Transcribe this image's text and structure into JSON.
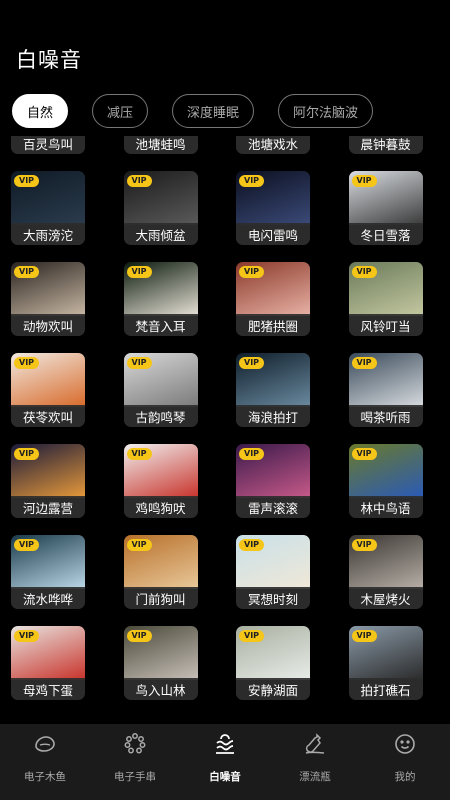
{
  "header": {
    "title": "白噪音"
  },
  "tabs": [
    "自然",
    "减压",
    "深度睡眠",
    "阿尔法脑波"
  ],
  "vip_badge": "VIP",
  "sounds": [
    {
      "label": "百灵鸟叫",
      "vip": false,
      "colors": [
        "#3a3520",
        "#6b5a2e"
      ]
    },
    {
      "label": "池塘蛙鸣",
      "vip": false,
      "colors": [
        "#1f4a22",
        "#3c7a36"
      ]
    },
    {
      "label": "池塘戏水",
      "vip": false,
      "colors": [
        "#1c5a4a",
        "#2f8a6e"
      ]
    },
    {
      "label": "晨钟暮鼓",
      "vip": false,
      "colors": [
        "#2a2a2a",
        "#4a4a4a"
      ]
    },
    {
      "label": "大雨滂沱",
      "vip": true,
      "colors": [
        "#0f1a25",
        "#2b3c4e"
      ]
    },
    {
      "label": "大雨倾盆",
      "vip": true,
      "colors": [
        "#1b1b1b",
        "#5a5a5a"
      ]
    },
    {
      "label": "电闪雷鸣",
      "vip": true,
      "colors": [
        "#0b0f1f",
        "#3b4a78"
      ]
    },
    {
      "label": "冬日雪落",
      "vip": true,
      "colors": [
        "#d9dde2",
        "#3a3a3a"
      ]
    },
    {
      "label": "动物欢叫",
      "vip": true,
      "colors": [
        "#2a2420",
        "#c8b8a4"
      ]
    },
    {
      "label": "梵音入耳",
      "vip": true,
      "colors": [
        "#0a1a0c",
        "#e8e2d8"
      ]
    },
    {
      "label": "肥猪拱圈",
      "vip": true,
      "colors": [
        "#8a3a2a",
        "#e8b2a6"
      ]
    },
    {
      "label": "风铃叮当",
      "vip": true,
      "colors": [
        "#6a7a5a",
        "#c4c8a0"
      ]
    },
    {
      "label": "茯苓欢叫",
      "vip": true,
      "colors": [
        "#f0e8e0",
        "#d86a2a"
      ]
    },
    {
      "label": "古韵鸣琴",
      "vip": true,
      "colors": [
        "#d8d8d8",
        "#7a7a7a"
      ]
    },
    {
      "label": "海浪拍打",
      "vip": true,
      "colors": [
        "#0f1e2a",
        "#6a8aa0"
      ]
    },
    {
      "label": "喝茶听雨",
      "vip": true,
      "colors": [
        "#3a4a5a",
        "#d8dce0"
      ]
    },
    {
      "label": "河边露营",
      "vip": true,
      "colors": [
        "#1a1a3a",
        "#e89a3a"
      ]
    },
    {
      "label": "鸡鸣狗吠",
      "vip": true,
      "colors": [
        "#f0f0f0",
        "#c8322a"
      ]
    },
    {
      "label": "雷声滚滚",
      "vip": true,
      "colors": [
        "#3a1a4a",
        "#c85a8a"
      ]
    },
    {
      "label": "林中鸟语",
      "vip": true,
      "colors": [
        "#6a7a2a",
        "#2a5ab8"
      ]
    },
    {
      "label": "流水哗哗",
      "vip": true,
      "colors": [
        "#1a3a4a",
        "#bcd8e8"
      ]
    },
    {
      "label": "门前狗叫",
      "vip": true,
      "colors": [
        "#b8702a",
        "#e8c89a"
      ]
    },
    {
      "label": "冥想时刻",
      "vip": true,
      "colors": [
        "#c8e0e8",
        "#f0e8d8"
      ]
    },
    {
      "label": "木屋烤火",
      "vip": true,
      "colors": [
        "#3a3632",
        "#b8b0a8"
      ]
    },
    {
      "label": "母鸡下蛋",
      "vip": true,
      "colors": [
        "#e8e4e0",
        "#c8322a"
      ]
    },
    {
      "label": "鸟入山林",
      "vip": true,
      "colors": [
        "#4a4a3a",
        "#c8c0b8"
      ]
    },
    {
      "label": "安静湖面",
      "vip": true,
      "colors": [
        "#a8b0a0",
        "#e8ece8"
      ]
    },
    {
      "label": "拍打礁石",
      "vip": true,
      "colors": [
        "#8a9aa8",
        "#2a2a2a"
      ]
    }
  ],
  "bottom_nav": [
    {
      "label": "电子木鱼",
      "icon": "wooden-fish-icon"
    },
    {
      "label": "电子手串",
      "icon": "bead-bracelet-icon"
    },
    {
      "label": "白噪音",
      "icon": "wave-sun-icon"
    },
    {
      "label": "漂流瓶",
      "icon": "drift-bottle-icon"
    },
    {
      "label": "我的",
      "icon": "smile-face-icon"
    }
  ]
}
